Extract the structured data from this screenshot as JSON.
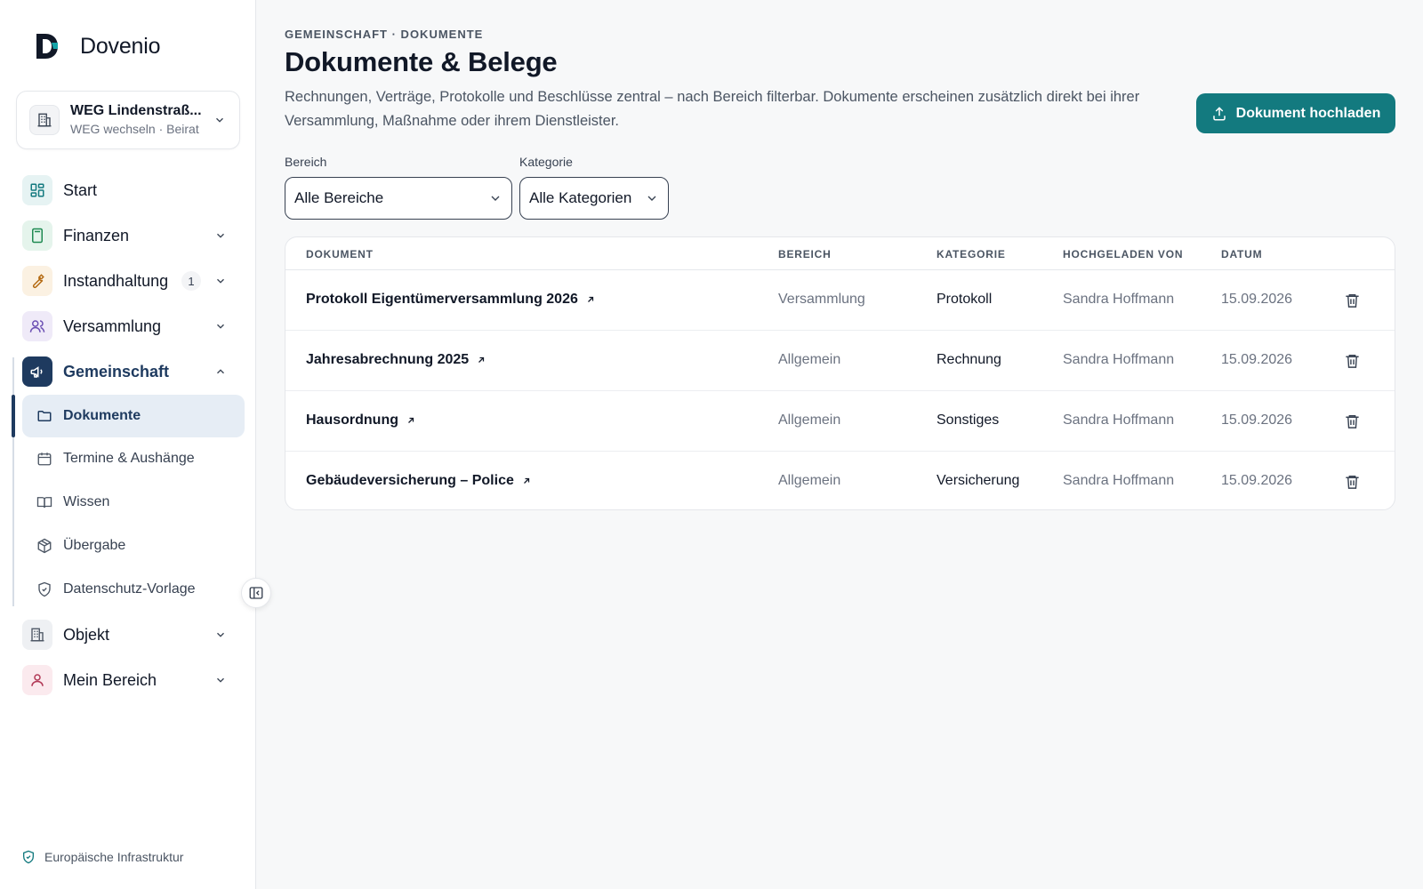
{
  "app": {
    "name": "Dovenio"
  },
  "weg": {
    "title": "WEG Lindenstraß...",
    "subtitle": "WEG wechseln · Beirat"
  },
  "nav": {
    "start": "Start",
    "finanzen": "Finanzen",
    "instandhaltung": "Instandhaltung",
    "instandhaltung_badge": "1",
    "versammlung": "Versammlung",
    "gemeinschaft": "Gemeinschaft",
    "objekt": "Objekt",
    "mein_bereich": "Mein Bereich"
  },
  "subnav": {
    "dokumente": "Dokumente",
    "termine": "Termine & Aushänge",
    "wissen": "Wissen",
    "uebergabe": "Übergabe",
    "datenschutz": "Datenschutz-Vorlage"
  },
  "footer": {
    "note": "Europäische Infrastruktur"
  },
  "page": {
    "breadcrumb": "GEMEINSCHAFT · DOKUMENTE",
    "title": "Dokumente & Belege",
    "description": "Rechnungen, Verträge, Protokolle und Beschlüsse zentral – nach Bereich filterbar. Dokumente erscheinen zusätzlich direkt bei ihrer Versammlung, Maßnahme oder ihrem Dienstleister.",
    "upload_label": "Dokument hochladen"
  },
  "filters": {
    "bereich_label": "Bereich",
    "bereich_value": "Alle Bereiche",
    "kategorie_label": "Kategorie",
    "kategorie_value": "Alle Kategorien"
  },
  "table": {
    "headers": {
      "dokument": "DOKUMENT",
      "bereich": "BEREICH",
      "kategorie": "KATEGORIE",
      "hochgeladen": "HOCHGELADEN VON",
      "datum": "DATUM"
    },
    "rows": [
      {
        "dokument": "Protokoll Eigentümerversammlung 2026",
        "bereich": "Versammlung",
        "kategorie": "Protokoll",
        "user": "Sandra Hoffmann",
        "datum": "15.09.2026"
      },
      {
        "dokument": "Jahresabrechnung 2025",
        "bereich": "Allgemein",
        "kategorie": "Rechnung",
        "user": "Sandra Hoffmann",
        "datum": "15.09.2026"
      },
      {
        "dokument": "Hausordnung",
        "bereich": "Allgemein",
        "kategorie": "Sonstiges",
        "user": "Sandra Hoffmann",
        "datum": "15.09.2026"
      },
      {
        "dokument": "Gebäudeversicherung – Police",
        "bereich": "Allgemein",
        "kategorie": "Versicherung",
        "user": "Sandra Hoffmann",
        "datum": "15.09.2026"
      }
    ]
  },
  "colors": {
    "accent": "#137a7f",
    "nav_active": "#1e3a5f"
  }
}
